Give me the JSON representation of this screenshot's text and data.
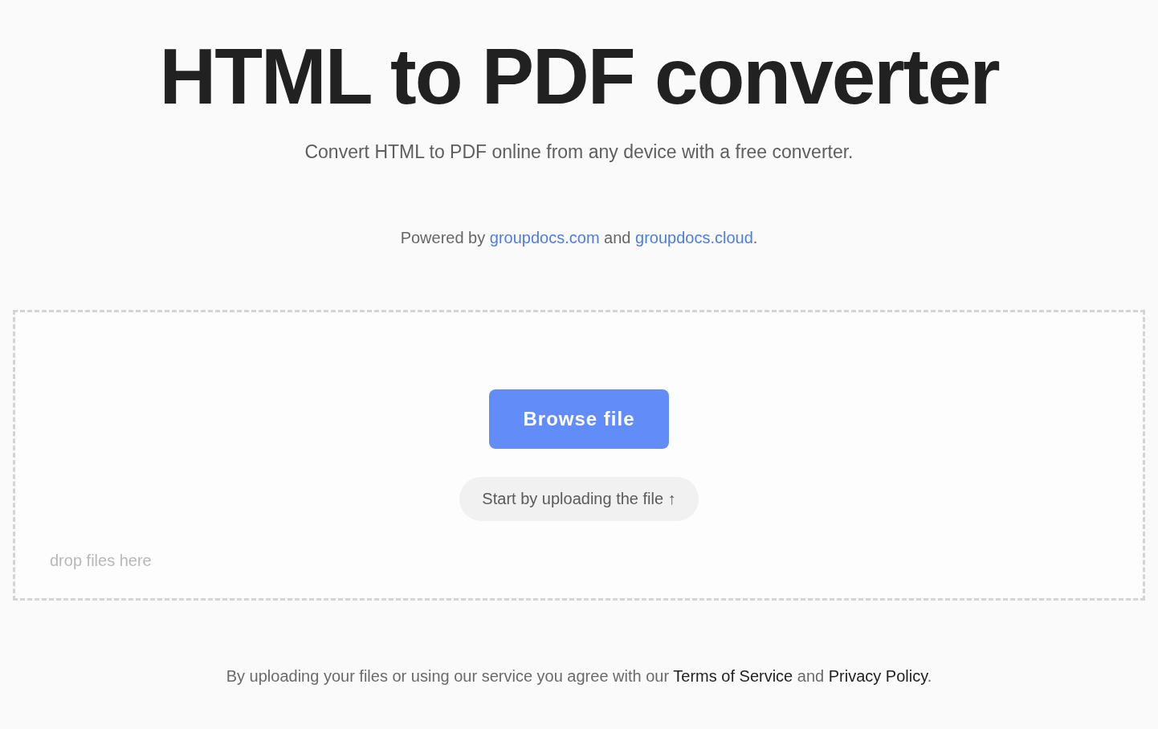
{
  "title": "HTML to PDF converter",
  "subtitle": "Convert HTML to PDF online from any device with a free converter.",
  "powered_by": [
    {
      "kind": "text",
      "text": "Powered by "
    },
    {
      "kind": "link",
      "text": "groupdocs.com"
    },
    {
      "kind": "text",
      "text": " and "
    },
    {
      "kind": "link",
      "text": "groupdocs.cloud"
    },
    {
      "kind": "text",
      "text": "."
    }
  ],
  "upload": {
    "button": "Browse file",
    "hint": "Start by uploading the file ↑",
    "drop_label": "drop files here"
  },
  "footer": [
    {
      "kind": "text",
      "text": "By uploading your files or using our service you agree with our "
    },
    {
      "kind": "link",
      "text": "Terms of Service"
    },
    {
      "kind": "text",
      "text": " and "
    },
    {
      "kind": "link",
      "text": "Privacy Policy"
    },
    {
      "kind": "text",
      "text": "."
    }
  ]
}
